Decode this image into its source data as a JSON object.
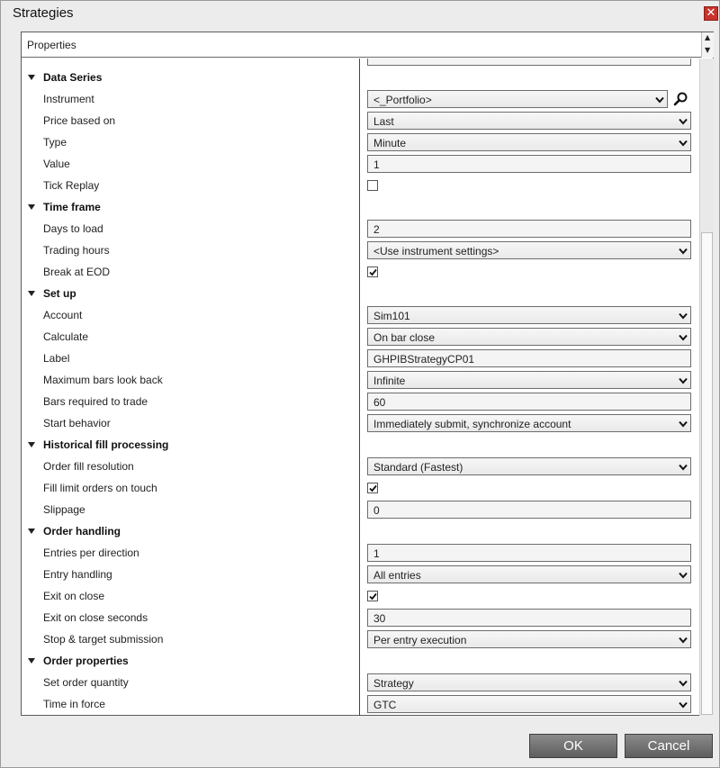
{
  "window": {
    "title": "Strategies",
    "close_glyph": "✕"
  },
  "panel": {
    "header": "Properties"
  },
  "rows": [
    {
      "type": "category",
      "label": "Data Series"
    },
    {
      "type": "select",
      "label": "Instrument",
      "value": "<_Portfolio>",
      "search": true
    },
    {
      "type": "select",
      "label": "Price based on",
      "value": "Last"
    },
    {
      "type": "select",
      "label": "Type",
      "value": "Minute"
    },
    {
      "type": "text",
      "label": "Value",
      "value": "1"
    },
    {
      "type": "check",
      "label": "Tick Replay",
      "checked": false
    },
    {
      "type": "category",
      "label": "Time frame"
    },
    {
      "type": "text",
      "label": "Days to load",
      "value": "2"
    },
    {
      "type": "select",
      "label": "Trading hours",
      "value": "<Use instrument settings>"
    },
    {
      "type": "check",
      "label": "Break at EOD",
      "checked": true
    },
    {
      "type": "category",
      "label": "Set up"
    },
    {
      "type": "select",
      "label": "Account",
      "value": "Sim101"
    },
    {
      "type": "select",
      "label": "Calculate",
      "value": "On bar close"
    },
    {
      "type": "text",
      "label": "Label",
      "value": "GHPIBStrategyCP01"
    },
    {
      "type": "select",
      "label": "Maximum bars look back",
      "value": "Infinite"
    },
    {
      "type": "text",
      "label": "Bars required to trade",
      "value": "60"
    },
    {
      "type": "select",
      "label": "Start behavior",
      "value": "Immediately submit, synchronize account"
    },
    {
      "type": "category",
      "label": "Historical fill processing"
    },
    {
      "type": "select",
      "label": "Order fill resolution",
      "value": "Standard (Fastest)"
    },
    {
      "type": "check",
      "label": "Fill limit orders on touch",
      "checked": true
    },
    {
      "type": "text",
      "label": "Slippage",
      "value": "0"
    },
    {
      "type": "category",
      "label": "Order handling"
    },
    {
      "type": "text",
      "label": "Entries per direction",
      "value": "1"
    },
    {
      "type": "select",
      "label": "Entry handling",
      "value": "All entries"
    },
    {
      "type": "check",
      "label": "Exit on close",
      "checked": true
    },
    {
      "type": "text",
      "label": "Exit on close seconds",
      "value": "30"
    },
    {
      "type": "select",
      "label": "Stop & target submission",
      "value": "Per entry execution"
    },
    {
      "type": "category",
      "label": "Order properties"
    },
    {
      "type": "select",
      "label": "Set order quantity",
      "value": "Strategy"
    },
    {
      "type": "select",
      "label": "Time in force",
      "value": "GTC"
    }
  ],
  "buttons": {
    "ok": "OK",
    "cancel": "Cancel"
  },
  "icons": {
    "search": "search-icon",
    "dropdown": "chevron-down-icon",
    "checkbox": "checkmark-icon",
    "collapse": "triangle-down-icon",
    "close": "close-icon"
  },
  "colors": {
    "close_red": "#c8332b",
    "button_gray": "#6f6f6f",
    "panel_border": "#5c5c5c"
  }
}
